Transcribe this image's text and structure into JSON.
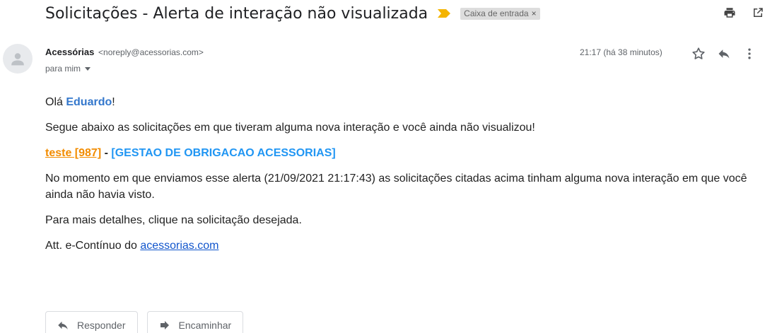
{
  "email": {
    "subject": "Solicitações - Alerta de interação não visualizada",
    "label": "Caixa de entrada",
    "label_remove": "×",
    "sender_name": "Acessórias",
    "sender_email": "<noreply@acessorias.com>",
    "recipient": "para mim",
    "time": "21:17 (há 38 minutos)"
  },
  "body": {
    "greeting_prefix": "Olá ",
    "greeting_name": "Eduardo",
    "greeting_suffix": "!",
    "intro": "Segue abaixo as solicitações em que tiveram alguma nova interação e você ainda não visualizou!",
    "request_link": "teste [987]",
    "request_sep": " - ",
    "request_category": "[GESTAO DE OBRIGACAO ACESSORIAS]",
    "alert_text": "No momento em que enviamos esse alerta (21/09/2021 21:17:43) as solicitações citadas acima tinham alguma nova interação em que você ainda não havia visto.",
    "details": "Para mais detalhes, clique na solicitação desejada.",
    "signature_prefix": "Att. e-Contínuo do ",
    "signature_link": "acessorias.com"
  },
  "actions": {
    "reply": "Responder",
    "forward": "Encaminhar"
  },
  "colors": {
    "importance": "#f4b400",
    "link_orange": "#f28c00",
    "category_blue": "#2196f3",
    "link_blue": "#1155cc"
  },
  "icons": [
    "importance-marker-icon",
    "print-icon",
    "open-new-window-icon",
    "avatar-person-icon",
    "star-icon",
    "reply-icon",
    "more-vertical-icon",
    "forward-icon"
  ]
}
